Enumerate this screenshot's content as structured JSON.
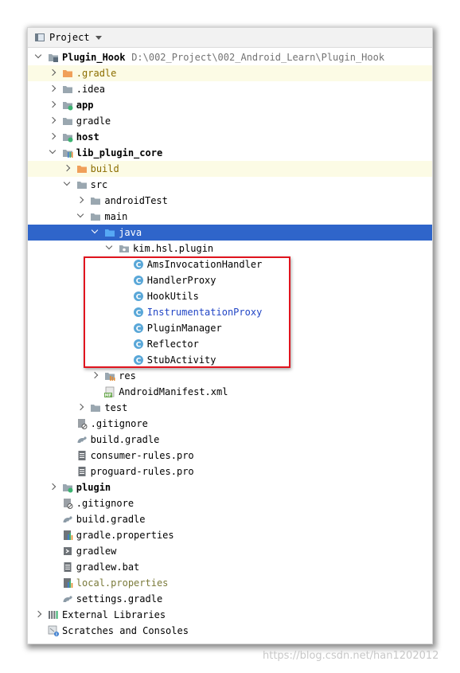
{
  "header": {
    "title": "Project",
    "icon": "project-window-icon"
  },
  "tree": [
    {
      "name": "Plugin_Hook",
      "path": "D:\\002_Project\\002_Android_Learn\\Plugin_Hook",
      "level": 0,
      "expanded": true,
      "icon": "module-icon",
      "style": "bold"
    },
    {
      "name": ".gradle",
      "level": 1,
      "expanded": false,
      "icon": "folder-orange-icon",
      "style": "orange",
      "excluded": true
    },
    {
      "name": ".idea",
      "level": 1,
      "expanded": false,
      "icon": "folder-icon"
    },
    {
      "name": "app",
      "level": 1,
      "expanded": false,
      "icon": "module-green-icon",
      "style": "bold"
    },
    {
      "name": "gradle",
      "level": 1,
      "expanded": false,
      "icon": "folder-icon"
    },
    {
      "name": "host",
      "level": 1,
      "expanded": false,
      "icon": "module-green-icon",
      "style": "bold"
    },
    {
      "name": "lib_plugin_core",
      "level": 1,
      "expanded": true,
      "icon": "library-module-icon",
      "style": "bold"
    },
    {
      "name": "build",
      "level": 2,
      "expanded": false,
      "icon": "folder-orange-icon",
      "style": "orange",
      "excluded": true
    },
    {
      "name": "src",
      "level": 2,
      "expanded": true,
      "icon": "folder-icon"
    },
    {
      "name": "androidTest",
      "level": 3,
      "expanded": false,
      "icon": "folder-icon"
    },
    {
      "name": "main",
      "level": 3,
      "expanded": true,
      "icon": "folder-icon"
    },
    {
      "name": "java",
      "level": 4,
      "expanded": true,
      "icon": "folder-blue-icon",
      "selected": true
    },
    {
      "name": "kim.hsl.plugin",
      "level": 5,
      "expanded": true,
      "icon": "package-icon"
    },
    {
      "name": "AmsInvocationHandler",
      "level": 6,
      "icon": "class-icon"
    },
    {
      "name": "HandlerProxy",
      "level": 6,
      "icon": "class-icon"
    },
    {
      "name": "HookUtils",
      "level": 6,
      "icon": "class-icon"
    },
    {
      "name": "InstrumentationProxy",
      "level": 6,
      "icon": "class-icon",
      "style": "blue"
    },
    {
      "name": "PluginManager",
      "level": 6,
      "icon": "class-icon"
    },
    {
      "name": "Reflector",
      "level": 6,
      "icon": "class-icon"
    },
    {
      "name": "StubActivity",
      "level": 6,
      "icon": "class-icon"
    },
    {
      "name": "res",
      "level": 4,
      "expanded": false,
      "icon": "res-folder-icon"
    },
    {
      "name": "AndroidManifest.xml",
      "level": 4,
      "icon": "manifest-icon"
    },
    {
      "name": "test",
      "level": 3,
      "expanded": false,
      "icon": "folder-icon"
    },
    {
      "name": ".gitignore",
      "level": 2,
      "icon": "gitignore-icon"
    },
    {
      "name": "build.gradle",
      "level": 2,
      "icon": "gradle-icon"
    },
    {
      "name": "consumer-rules.pro",
      "level": 2,
      "icon": "text-file-icon"
    },
    {
      "name": "proguard-rules.pro",
      "level": 2,
      "icon": "text-file-icon"
    },
    {
      "name": "plugin",
      "level": 1,
      "expanded": false,
      "icon": "module-green-icon",
      "style": "bold"
    },
    {
      "name": ".gitignore",
      "level": 1,
      "icon": "gitignore-icon"
    },
    {
      "name": "build.gradle",
      "level": 1,
      "icon": "gradle-icon"
    },
    {
      "name": "gradle.properties",
      "level": 1,
      "icon": "properties-icon"
    },
    {
      "name": "gradlew",
      "level": 1,
      "icon": "shell-script-icon"
    },
    {
      "name": "gradlew.bat",
      "level": 1,
      "icon": "text-file-icon"
    },
    {
      "name": "local.properties",
      "level": 1,
      "icon": "properties-icon",
      "style": "olive"
    },
    {
      "name": "settings.gradle",
      "level": 1,
      "icon": "gradle-icon"
    },
    {
      "name": "External Libraries",
      "level": 0,
      "expanded": false,
      "icon": "libraries-icon"
    },
    {
      "name": "Scratches and Consoles",
      "level": 0,
      "icon": "scratches-icon"
    }
  ],
  "colors": {
    "selection": "#2f65ca",
    "excluded_background": "#fcfbe5",
    "highlight_border": "#e0141e"
  },
  "watermark": "https://blog.csdn.net/han1202012"
}
